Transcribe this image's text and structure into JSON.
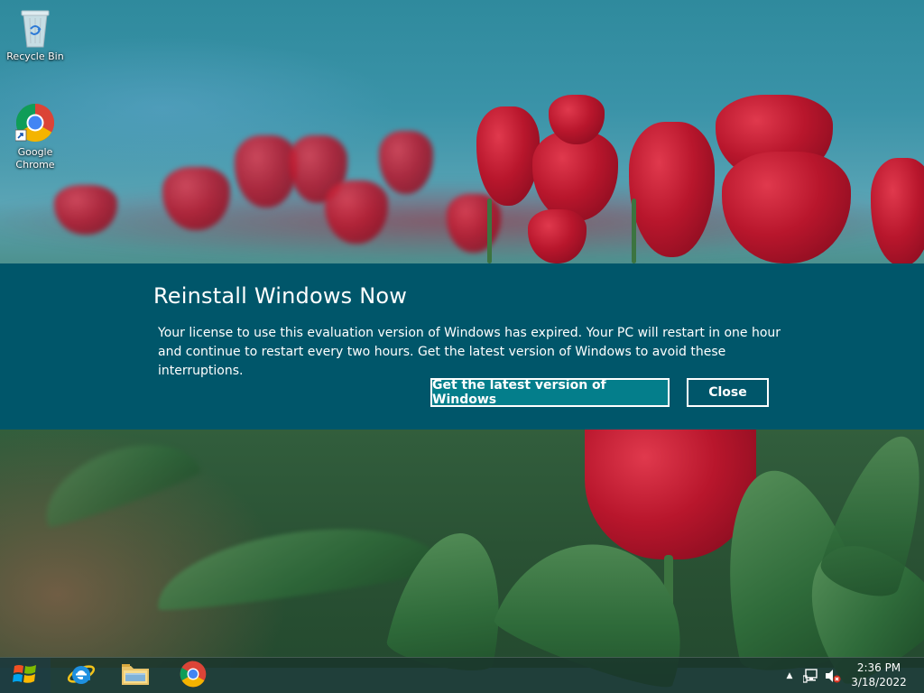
{
  "desktop": {
    "icons": [
      {
        "label": "Recycle Bin",
        "icon": "recycle-bin-icon"
      },
      {
        "label": "Google Chrome",
        "icon": "chrome-icon"
      }
    ]
  },
  "banner": {
    "title": "Reinstall Windows Now",
    "message": "Your license to use this evaluation version of Windows has expired. Your PC will restart in one hour and continue to restart every two hours. Get the latest version of Windows to avoid these interruptions.",
    "primary_button": "Get the latest version of Windows",
    "secondary_button": "Close",
    "background_color": "#00566a",
    "primary_button_color": "#047e8b"
  },
  "taskbar": {
    "start": {
      "icon": "windows-logo-icon"
    },
    "pinned": [
      {
        "app": "Internet Explorer",
        "icon": "internet-explorer-icon"
      },
      {
        "app": "File Explorer",
        "icon": "file-explorer-icon"
      },
      {
        "app": "Google Chrome",
        "icon": "chrome-icon"
      }
    ],
    "tray": {
      "icons": [
        "show-hidden-icons-chevron",
        "network-icon",
        "volume-muted-icon"
      ],
      "time": "2:36 PM",
      "date": "3/18/2022"
    }
  }
}
